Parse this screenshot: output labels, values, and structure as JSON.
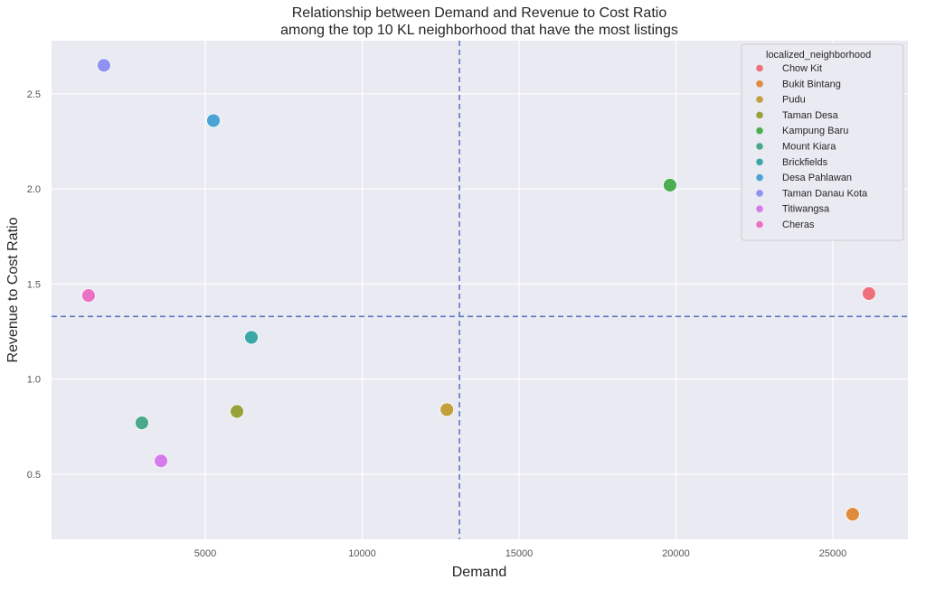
{
  "chart_data": {
    "type": "scatter",
    "title": [
      "Relationship between Demand and Revenue to Cost Ratio",
      "among the top 10 KL neighborhood that have the most listings"
    ],
    "xlabel": "Demand",
    "ylabel": "Revenue to Cost Ratio",
    "xlim": [
      101,
      27392
    ],
    "ylim": [
      0.158,
      2.78
    ],
    "xticks": [
      5000,
      10000,
      15000,
      20000,
      25000
    ],
    "xtick_labels": [
      "5000",
      "10000",
      "15000",
      "20000",
      "25000"
    ],
    "yticks": [
      0.5,
      1.0,
      1.5,
      2.0,
      2.5
    ],
    "ytick_labels": [
      "0.5",
      "1.0",
      "1.5",
      "2.0",
      "2.5"
    ],
    "grid": true,
    "background": "#eaeaf2",
    "legend": {
      "title": "localized_neighborhood",
      "placement": "top-right"
    },
    "series": [
      {
        "name": "Chow Kit",
        "color": "#f0707e",
        "x": 26150,
        "y": 1.45
      },
      {
        "name": "Bukit Bintang",
        "color": "#e08a3c",
        "x": 25630,
        "y": 0.29
      },
      {
        "name": "Pudu",
        "color": "#c2a03c",
        "x": 12700,
        "y": 0.84
      },
      {
        "name": "Taman Desa",
        "color": "#98a23a",
        "x": 6010,
        "y": 0.83
      },
      {
        "name": "Kampung Baru",
        "color": "#4cae50",
        "x": 19810,
        "y": 2.02
      },
      {
        "name": "Mount Kiara",
        "color": "#4aa98a",
        "x": 2980,
        "y": 0.77
      },
      {
        "name": "Brickfields",
        "color": "#3da7a8",
        "x": 6470,
        "y": 1.22
      },
      {
        "name": "Desa Pahlawan",
        "color": "#4aa3d4",
        "x": 5260,
        "y": 2.36
      },
      {
        "name": "Taman Danau Kota",
        "color": "#8f92f0",
        "x": 1770,
        "y": 2.65
      },
      {
        "name": "Titiwangsa",
        "color": "#d57bec",
        "x": 3590,
        "y": 0.57
      },
      {
        "name": "Cheras",
        "color": "#ec70c6",
        "x": 1280,
        "y": 1.44
      }
    ],
    "reference_lines": {
      "vertical_x": 13100,
      "horizontal_y": 1.33,
      "color": "#5b78c2",
      "style": "dashed"
    }
  }
}
